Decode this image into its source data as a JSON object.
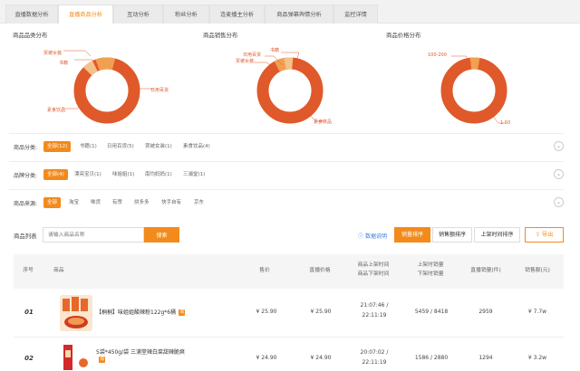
{
  "tabs": [
    "直播数据分析",
    "直播商品分析",
    "互动分析",
    "粉丝分析",
    "连麦播主分析",
    "商品弹幕舆情分析",
    "监控详情"
  ],
  "charts": {
    "category": {
      "title": "商品品类分布",
      "labels": [
        "贾被女装",
        "书籍",
        "日用百货",
        "素食饮品"
      ]
    },
    "sales": {
      "title": "商品销售分布",
      "labels": [
        "书籍",
        "日用百货",
        "贾被女装",
        "素食饮品"
      ]
    },
    "price": {
      "title": "商品价格分布",
      "labels": [
        "100-200",
        "1-50"
      ]
    }
  },
  "filters": {
    "category": {
      "label": "商品分类:",
      "chips": [
        "全部(12)",
        "书籍(1)",
        "日用百货(5)",
        "贾被女装(1)",
        "素食饮品(4)"
      ]
    },
    "brand": {
      "label": "品牌分类:",
      "chips": [
        "全部(4)",
        "漂亮宝贝(1)",
        "味姐姐(1)",
        "南均妈妈(1)",
        "三浦堂(1)"
      ]
    },
    "source": {
      "label": "商品来源:",
      "chips": [
        "全部",
        "淘宝",
        "唯货",
        "有赞",
        "拼多多",
        "快手自有",
        "京东"
      ]
    }
  },
  "list": {
    "label": "商品列表",
    "search_placeholder": "请输入商品名称",
    "search_button": "搜索",
    "data_desc": "数据说明",
    "sort_buttons": [
      "销量排序",
      "销售额排序",
      "上架时间排序"
    ],
    "export": "导出"
  },
  "table": {
    "headers": {
      "index": "序号",
      "product": "商品",
      "price": "售价",
      "live_price": "直播价格",
      "time1": "商品上架时间",
      "time2": "商品下架时间",
      "sales1": "上架时销量",
      "sales2": "下架时销量",
      "live_sales": "直播销量(件)",
      "amount": "销售额(元)"
    },
    "rows": [
      {
        "index": "01",
        "name": "【桐桐】味姐姐酸辣粉122g*6桶",
        "price": "¥ 25.90",
        "live_price": "¥ 25.90",
        "time_on": "21:07:46 /",
        "time_off": "22:11:19",
        "sales": "5459 / 8418",
        "live_sales": "2959",
        "amount": "¥ 7.7w"
      },
      {
        "index": "02",
        "name": "5袋*450g/袋 三浦堂辣白菜甜辣脆爽",
        "price": "¥ 24.90",
        "live_price": "¥ 24.90",
        "time_on": "20:07:02 /",
        "time_off": "22:11:19",
        "sales": "1586 / 2880",
        "live_sales": "1294",
        "amount": "¥ 3.2w"
      }
    ]
  },
  "colors": {
    "accent": "#f28a1c",
    "donut_main": "#e0592a",
    "donut_alt": "#f0a050"
  },
  "icons": {
    "expand": "chevron-down-icon",
    "desc": "question-circle-icon",
    "export": "export-icon",
    "tag": "tag-icon"
  }
}
